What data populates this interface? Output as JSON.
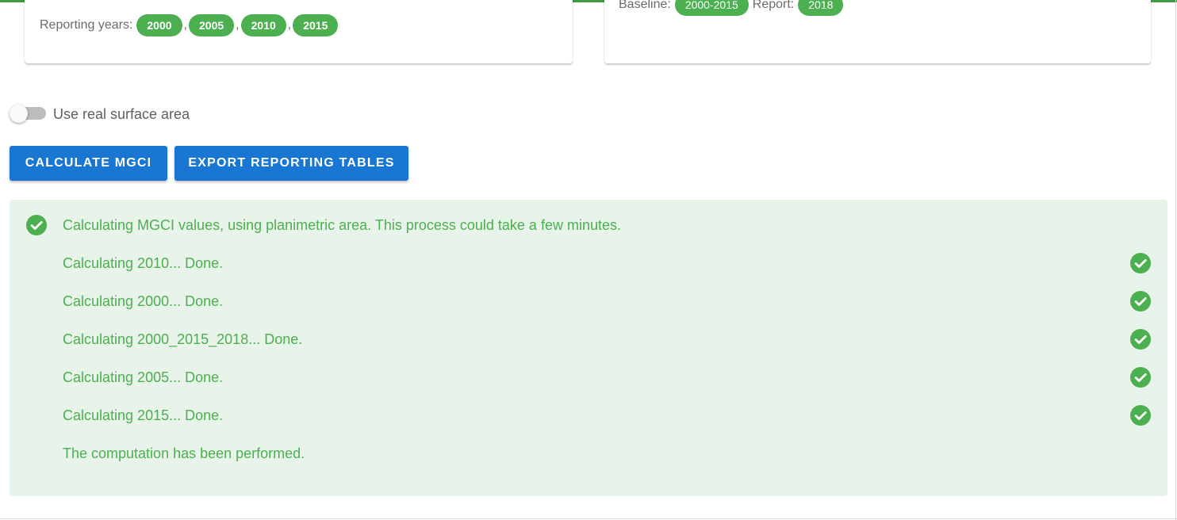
{
  "colors": {
    "accent_green": "#4caf50",
    "button_blue": "#1976d2",
    "panel_bg": "#e8f4e9"
  },
  "left_card": {
    "reporting_label": "Reporting years:",
    "years": [
      "2000",
      "2005",
      "2010",
      "2015"
    ]
  },
  "right_card": {
    "baseline_label": "Baseline:",
    "baseline_value": "2000-2015",
    "report_label": "Report:",
    "report_value": "2018"
  },
  "toggle": {
    "label": "Use real surface area",
    "checked": false
  },
  "buttons": {
    "calculate": "CALCULATE MGCI",
    "export": "EXPORT REPORTING TABLES"
  },
  "status_panel": {
    "header": "Calculating MGCI values, using planimetric area. This process could take a few minutes.",
    "steps": [
      "Calculating 2010... Done.",
      "Calculating 2000... Done.",
      "Calculating 2000_2015_2018... Done.",
      "Calculating 2005... Done.",
      "Calculating 2015... Done."
    ],
    "footer": "The computation has been performed.",
    "icon": "check-circle-icon"
  }
}
